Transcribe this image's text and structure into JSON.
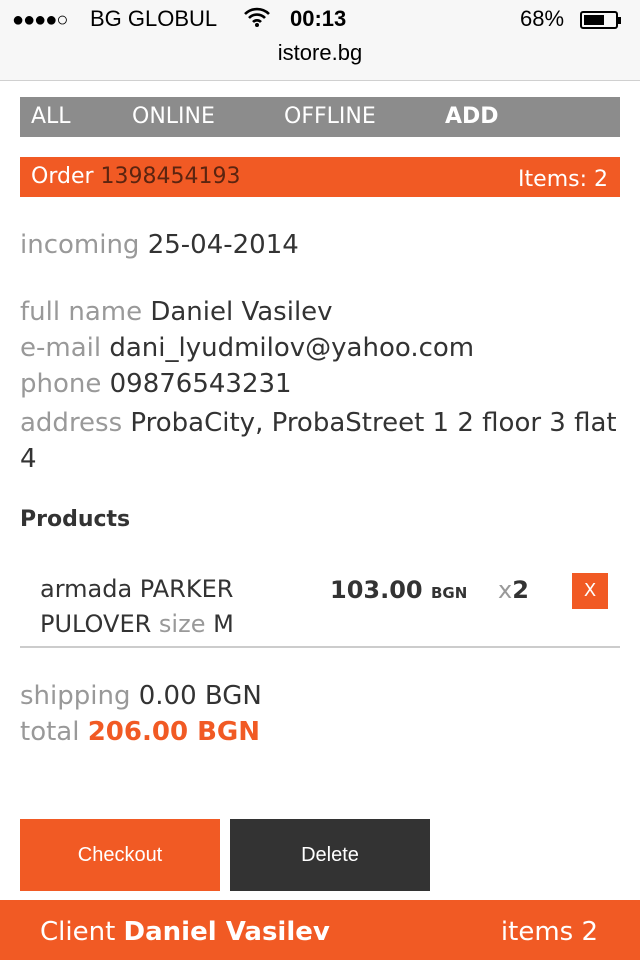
{
  "status_bar": {
    "signal": "●●●●○",
    "carrier": "BG GLOBUL",
    "time": "00:13",
    "battery": "68%",
    "battery_level": 0.68
  },
  "url": "istore.bg",
  "nav": {
    "all": "ALL",
    "online": "ONLINE",
    "offline": "OFFLINE",
    "add": "ADD"
  },
  "order": {
    "label": "Order",
    "number": "1398454193",
    "items_label": "Items: 2"
  },
  "details": {
    "incoming_label": "incoming",
    "incoming_value": "25-04-2014",
    "full_name_label": "full name",
    "full_name_value": "Daniel Vasilev",
    "email_label": "e-mail",
    "email_value": "dani_lyudmilov@yahoo.com",
    "phone_label": "phone",
    "phone_value": "09876543231",
    "address_label": "address",
    "address_value": "ProbaCity, ProbaStreet 1 2 floor 3 flat 4"
  },
  "products": {
    "heading": "Products",
    "items": [
      {
        "name": "armada PARKER PULOVER",
        "size_label": "size",
        "size_value": "M",
        "price": "103.00",
        "currency": "BGN",
        "qty_prefix": "x",
        "qty": "2",
        "remove_label": "X"
      }
    ]
  },
  "totals": {
    "shipping_label": "shipping",
    "shipping_value": "0.00 BGN",
    "total_label": "total",
    "total_value": "206.00 BGN"
  },
  "buttons": {
    "checkout": "Checkout",
    "delete": "Delete"
  },
  "footer": {
    "client_label": "Client",
    "client_name": "Daniel Vasilev",
    "items_label": "items 2"
  },
  "colors": {
    "accent": "#f15a24",
    "nav_bg": "#8c8c8c",
    "dark_button": "#333333",
    "muted_text": "#999999"
  }
}
